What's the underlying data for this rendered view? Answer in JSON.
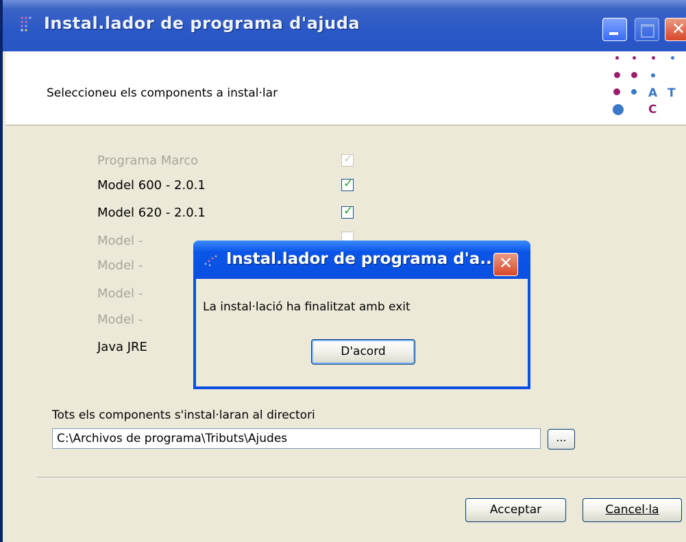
{
  "window": {
    "title": "Instal.lador de programa d'ajuda",
    "subtitle": "Seleccioneu els components a instal·lar",
    "logo_letters": [
      "A",
      "T",
      "C"
    ]
  },
  "components": [
    {
      "label": "Programa Marco",
      "checked": true,
      "disabled": true
    },
    {
      "label": "Model 600 - 2.0.1",
      "checked": true,
      "disabled": false
    },
    {
      "label": "Model 620 - 2.0.1",
      "checked": true,
      "disabled": false
    },
    {
      "label": "Model -",
      "checked": false,
      "disabled": true
    },
    {
      "label": "Model -",
      "checked": false,
      "disabled": true
    },
    {
      "label": "Model -",
      "checked": false,
      "disabled": true
    },
    {
      "label": "Model -",
      "checked": false,
      "disabled": true
    },
    {
      "label": "Java JRE",
      "checked": false,
      "disabled": false
    }
  ],
  "directory": {
    "label": "Tots els components s'instal·laran al directori",
    "value": "C:\\Archivos de programa\\Tributs\\Ajudes",
    "browse_label": "..."
  },
  "buttons": {
    "accept": "Acceptar",
    "cancel": "Cancel·la"
  },
  "dialog": {
    "title": "Instal.lador de programa d'a...",
    "message": "La instal·lació ha finalitzat amb exit",
    "ok_label": "D'acord"
  },
  "colors": {
    "titlebar": "#2b58c7",
    "logo_magenta": "#9b1e6c",
    "logo_blue": "#3a78c9"
  }
}
